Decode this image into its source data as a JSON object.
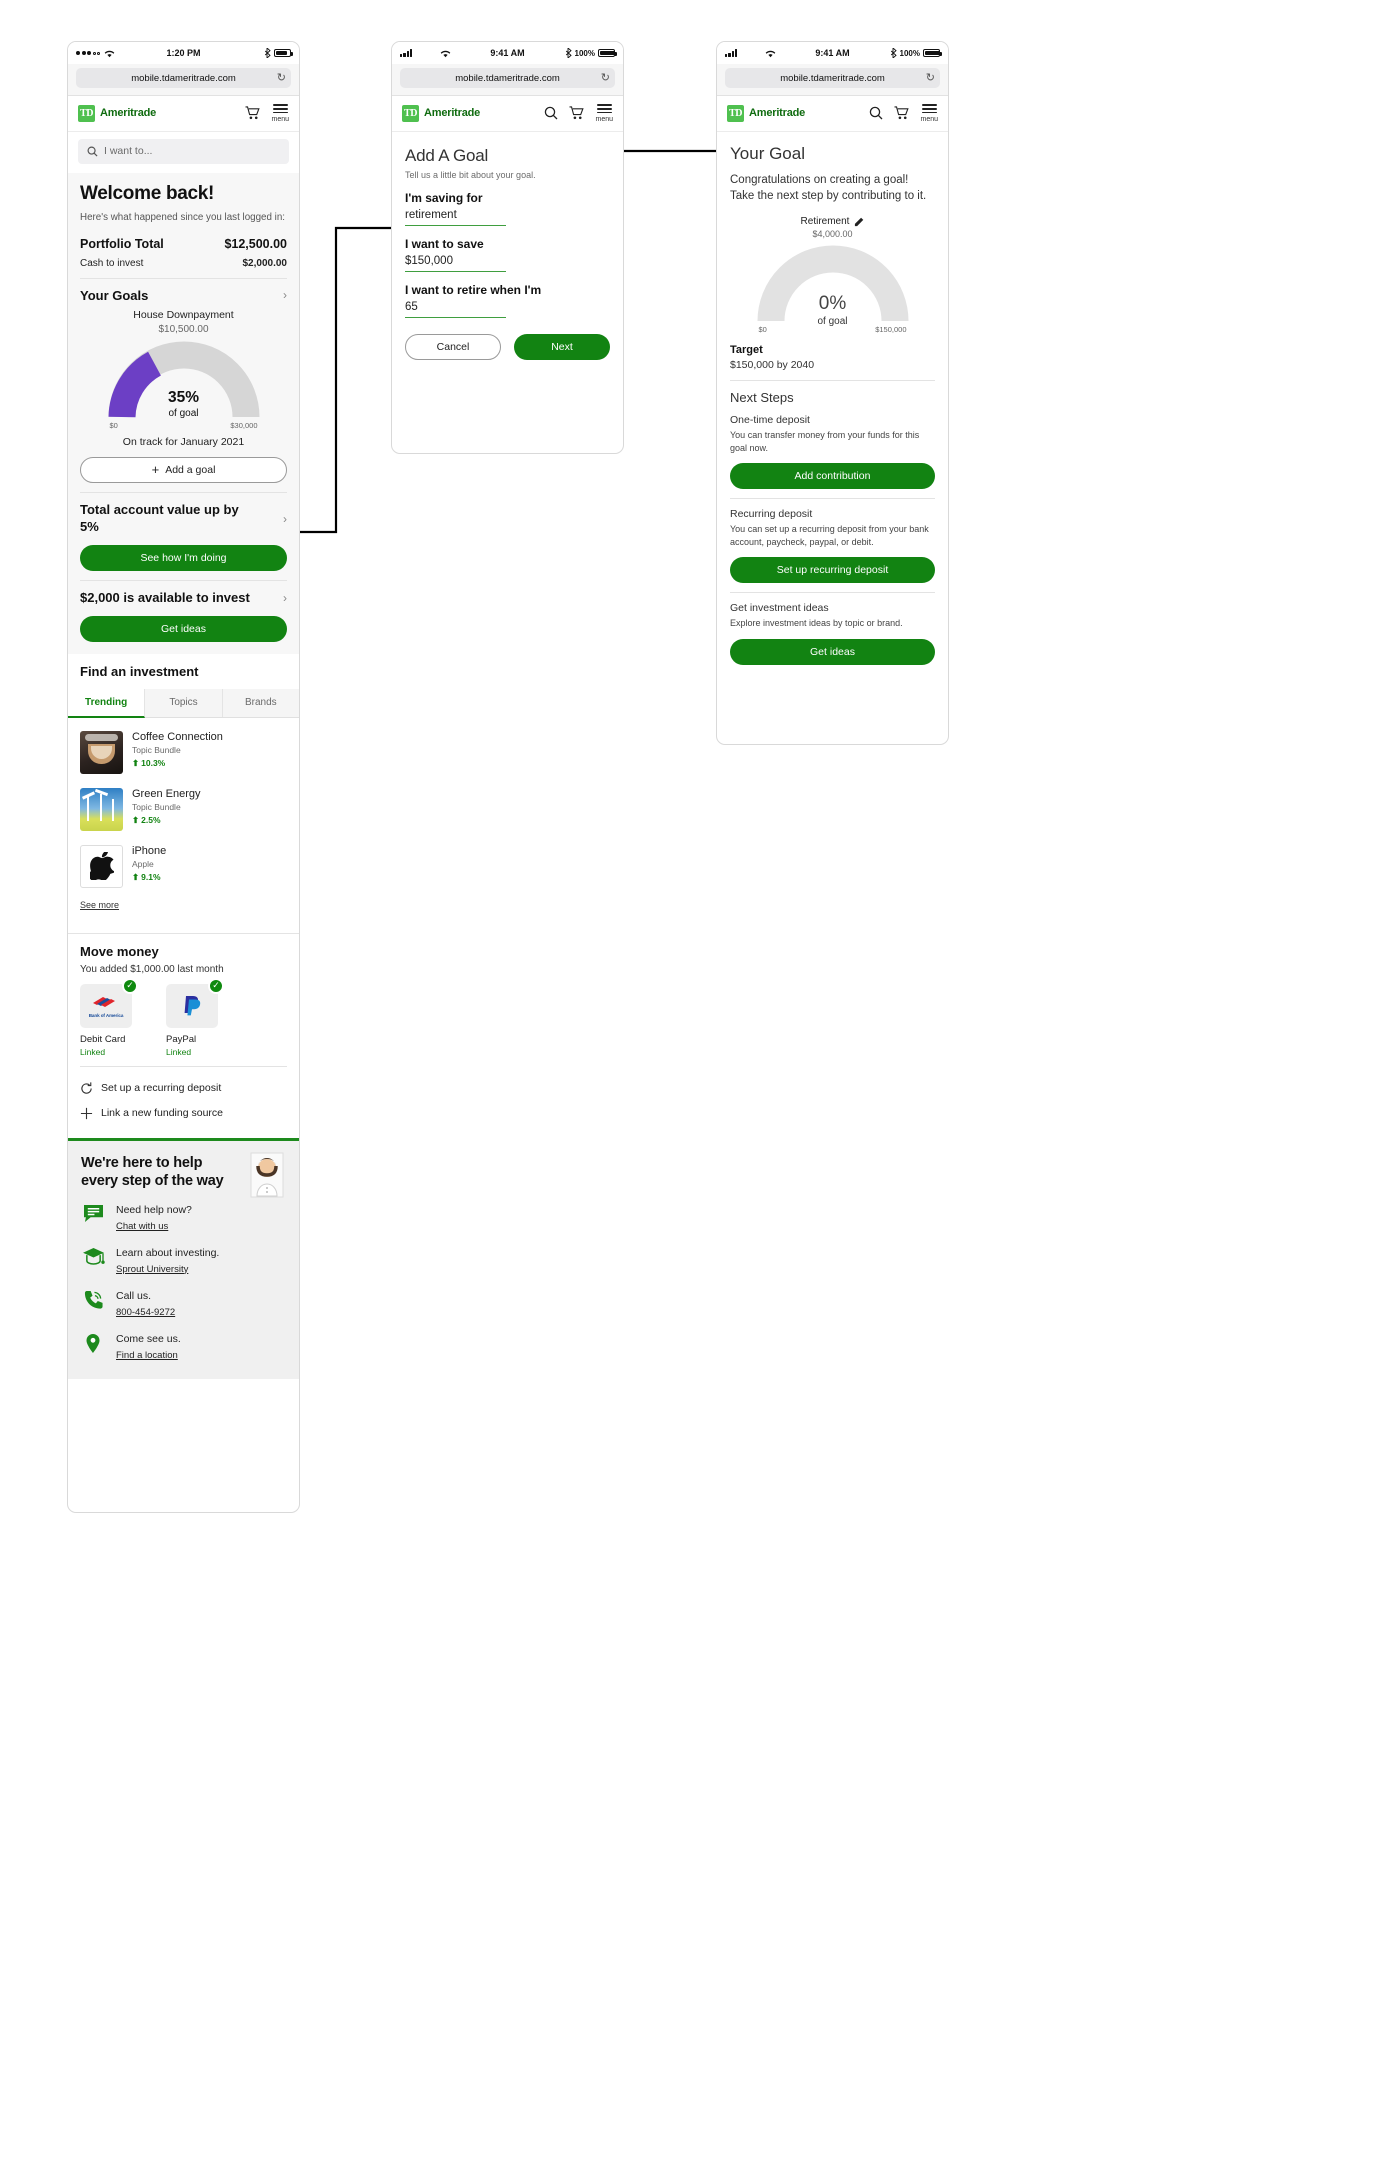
{
  "phone1": {
    "status": {
      "time": "1:20 PM",
      "battery": "",
      "signal_dots": 5,
      "signal_filled": 3
    },
    "url": "mobile.tdameritrade.com",
    "reload_icon": "reload-icon",
    "brand": {
      "mark": "TD",
      "name": "Ameritrade"
    },
    "header_icons": [
      "cart-icon",
      "menu-icon"
    ],
    "menu_label": "menu",
    "search_placeholder": "I want to...",
    "welcome": {
      "title": "Welcome back!",
      "subtitle": "Here's what happened since you last logged in:",
      "portfolio_label": "Portfolio Total",
      "portfolio_value": "$12,500.00",
      "cash_label": "Cash to invest",
      "cash_value": "$2,000.00"
    },
    "goals": {
      "heading": "Your Goals",
      "goal_name": "House Downpayment",
      "goal_amount": "$10,500.00",
      "percent": "35%",
      "percent_label": "of goal",
      "axis_min": "$0",
      "axis_max": "$30,000",
      "ontrack": "On track for January 2021",
      "add_goal": "Add a goal"
    },
    "account": {
      "headline": "Total account value up by 5%",
      "cta": "See how I'm doing"
    },
    "invest": {
      "headline": "$2,000 is available to invest",
      "cta": "Get ideas"
    },
    "find": {
      "heading": "Find an investment",
      "tabs": [
        {
          "label": "Trending",
          "active": true
        },
        {
          "label": "Topics",
          "active": false
        },
        {
          "label": "Brands",
          "active": false
        }
      ],
      "items": [
        {
          "name": "Coffee Connection",
          "sub": "Topic Bundle",
          "change": "10.3%",
          "thumb": "coffee-cup-photo"
        },
        {
          "name": "Green Energy",
          "sub": "Topic Bundle",
          "change": "2.5%",
          "thumb": "wind-turbines-photo"
        },
        {
          "name": "iPhone",
          "sub": "Apple",
          "change": "9.1%",
          "thumb": "apple-logo"
        }
      ],
      "see_more": "See more"
    },
    "move_money": {
      "heading": "Move money",
      "subtitle": "You added $1,000.00 last month",
      "sources": [
        {
          "name": "Debit Card",
          "status": "Linked",
          "logo": "bank-of-america-logo"
        },
        {
          "name": "PayPal",
          "status": "Linked",
          "logo": "paypal-logo"
        }
      ],
      "links": [
        {
          "label": "Set up a recurring deposit",
          "icon": "recurring-icon"
        },
        {
          "label": "Link a new funding source",
          "icon": "plus-icon"
        }
      ]
    },
    "help": {
      "heading": "We're here to help every step of the way",
      "rows": [
        {
          "title": "Need help now?",
          "link": "Chat with us",
          "icon": "chat-icon"
        },
        {
          "title": "Learn about investing.",
          "link": "Sprout University",
          "icon": "graduation-cap-icon"
        },
        {
          "title": "Call us.",
          "link": "800-454-9272",
          "icon": "phone-icon"
        },
        {
          "title": "Come see us.",
          "link": "Find a location",
          "icon": "map-pin-icon"
        }
      ]
    }
  },
  "phone2": {
    "status": {
      "time": "9:41 AM",
      "battery": "100%"
    },
    "url": "mobile.tdameritrade.com",
    "brand": {
      "mark": "TD",
      "name": "Ameritrade"
    },
    "menu_label": "menu",
    "title": "Add A Goal",
    "subtitle": "Tell us a little bit about your goal.",
    "fields": [
      {
        "label": "I'm saving for",
        "value": "retirement"
      },
      {
        "label": "I want to save",
        "value": "$150,000"
      },
      {
        "label": "I want to retire when I'm",
        "value": "65"
      }
    ],
    "cancel": "Cancel",
    "next": "Next"
  },
  "phone3": {
    "status": {
      "time": "9:41 AM",
      "battery": "100%"
    },
    "url": "mobile.tdameritrade.com",
    "brand": {
      "mark": "TD",
      "name": "Ameritrade"
    },
    "menu_label": "menu",
    "title": "Your Goal",
    "body": "Congratulations on creating a goal! Take the next step by contributing to it.",
    "goal_name": "Retirement",
    "goal_amount": "$4,000.00",
    "percent": "0%",
    "percent_label": "of goal",
    "axis_min": "$0",
    "axis_max": "$150,000",
    "target_label": "Target",
    "target_value": "$150,000 by 2040",
    "next_steps_heading": "Next Steps",
    "steps": [
      {
        "title": "One-time deposit",
        "desc": "You can transfer money from your funds for this goal now.",
        "cta": "Add contribution"
      },
      {
        "title": "Recurring deposit",
        "desc": "You can set up a recurring deposit from your bank account, paycheck, paypal, or debit.",
        "cta": "Set up recurring deposit"
      },
      {
        "title": "Get investment ideas",
        "desc": "Explore investment ideas by topic or brand.",
        "cta": "Get ideas"
      }
    ]
  },
  "colors": {
    "brand_green": "#128312",
    "logo_green": "#4fc04f",
    "gauge_purple": "#6c3fc5",
    "gauge_track": "#d6d6d6",
    "panel_bg": "#f7f7f7"
  },
  "chart_data": [
    {
      "type": "pie",
      "title": "House Downpayment",
      "subtitle": "$10,500.00",
      "categories": [
        "progress",
        "remaining"
      ],
      "values": [
        35,
        65
      ],
      "center_label": "35%",
      "center_sublabel": "of goal",
      "axis_min_label": "$0",
      "axis_max_label": "$30,000",
      "annotation": "On track for January 2021",
      "colors": [
        "#6c3fc5",
        "#d6d6d6"
      ]
    },
    {
      "type": "pie",
      "title": "Retirement",
      "subtitle": "$4,000.00",
      "categories": [
        "progress",
        "remaining"
      ],
      "values": [
        0,
        100
      ],
      "center_label": "0%",
      "center_sublabel": "of goal",
      "axis_min_label": "$0",
      "axis_max_label": "$150,000",
      "annotation": "",
      "colors": [
        "#6c3fc5",
        "#e2e2e2"
      ]
    }
  ]
}
